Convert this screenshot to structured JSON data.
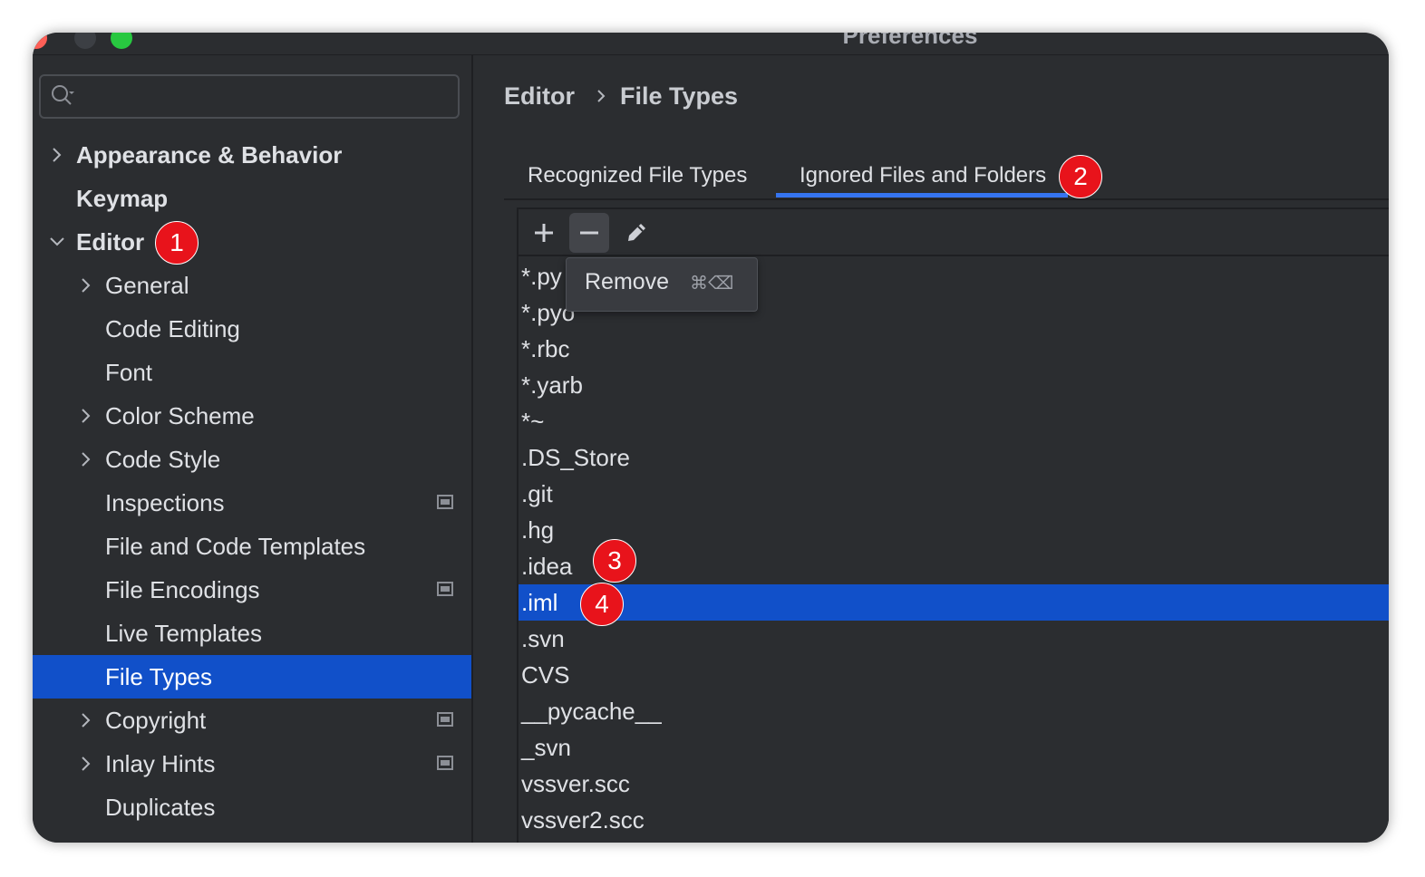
{
  "window": {
    "title": "Preferences"
  },
  "search": {
    "placeholder": ""
  },
  "sidebar": {
    "items": [
      {
        "label": "Appearance & Behavior"
      },
      {
        "label": "Keymap"
      },
      {
        "label": "Editor"
      },
      {
        "label": "General"
      },
      {
        "label": "Code Editing"
      },
      {
        "label": "Font"
      },
      {
        "label": "Color Scheme"
      },
      {
        "label": "Code Style"
      },
      {
        "label": "Inspections"
      },
      {
        "label": "File and Code Templates"
      },
      {
        "label": "File Encodings"
      },
      {
        "label": "Live Templates"
      },
      {
        "label": "File Types"
      },
      {
        "label": "Copyright"
      },
      {
        "label": "Inlay Hints"
      },
      {
        "label": "Duplicates"
      }
    ],
    "selected": "File Types"
  },
  "breadcrumb": {
    "parent": "Editor",
    "current": "File Types"
  },
  "tabs": [
    {
      "label": "Recognized File Types"
    },
    {
      "label": "Ignored Files and Folders"
    }
  ],
  "active_tab": "Ignored Files and Folders",
  "tooltip": {
    "label": "Remove",
    "shortcut": "⌘⌫"
  },
  "ignored_list": [
    "*.py",
    "*.pyo",
    "*.rbc",
    "*.yarb",
    "*~",
    ".DS_Store",
    ".git",
    ".hg",
    ".idea",
    ".iml",
    ".svn",
    "CVS",
    "__pycache__",
    "_svn",
    "vssver.scc",
    "vssver2.scc"
  ],
  "selected_entry": ".iml",
  "callouts": [
    "1",
    "2",
    "3",
    "4"
  ],
  "colors": {
    "selection": "#1150c9",
    "tab_underline": "#3574f0",
    "callout": "#e8131b"
  }
}
